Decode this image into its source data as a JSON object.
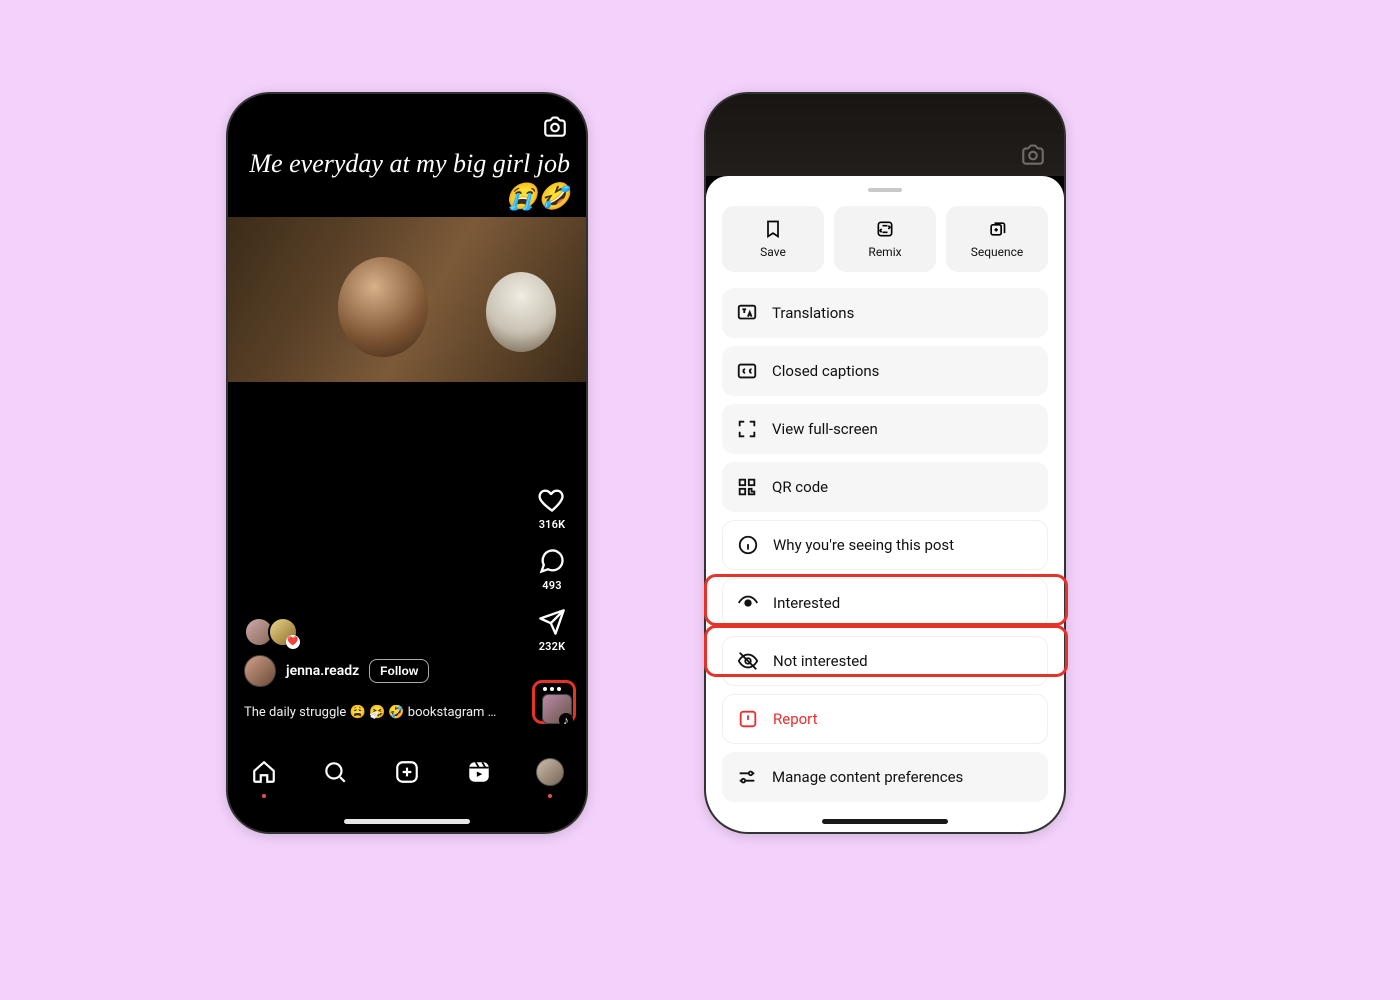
{
  "reel": {
    "overlay_text": "Me everyday at my big girl job 😭🤣",
    "likes": "316K",
    "comments": "493",
    "shares": "232K",
    "author": "jenna.readz",
    "follow_label": "Follow",
    "caption": "The daily struggle 😩 🤧 🤣  bookstagram …"
  },
  "tabs": {
    "home": "Home",
    "search": "Search",
    "create": "Create",
    "reels": "Reels",
    "profile": "Profile"
  },
  "sheet": {
    "actions": {
      "save": "Save",
      "remix": "Remix",
      "sequence": "Sequence"
    },
    "items": {
      "translations": "Translations",
      "closed_captions": "Closed captions",
      "fullscreen": "View full-screen",
      "qr": "QR code",
      "why": "Why you're seeing this post",
      "interested": "Interested",
      "not_interested": "Not interested",
      "report": "Report",
      "manage": "Manage content preferences"
    }
  },
  "highlight_color": "#e6332a"
}
